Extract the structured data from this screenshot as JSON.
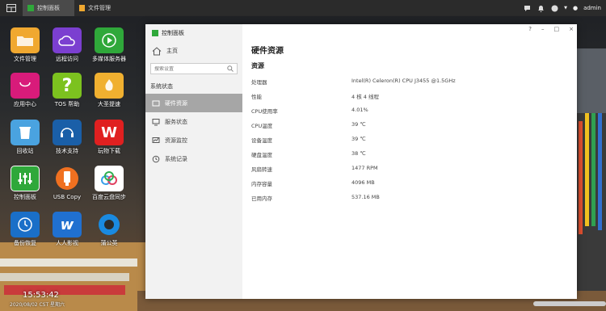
{
  "taskbar": {
    "tabs": [
      {
        "label": "控制面板",
        "active": true
      },
      {
        "label": "文件管理",
        "active": false
      }
    ],
    "user": "admin"
  },
  "desktop": {
    "icons": [
      {
        "label": "文件管理",
        "icon": "folder-icon",
        "color": "#2d2d2d"
      },
      {
        "label": "远程访问",
        "icon": "cloud-icon",
        "color": "#7b3fd0"
      },
      {
        "label": "多媒体服务器",
        "icon": "play-icon",
        "color": "#2fa83a"
      },
      {
        "label": "应用中心",
        "icon": "bag-icon",
        "color": "#d81b7a"
      },
      {
        "label": "TOS 帮助",
        "icon": "question-icon",
        "color": "#7cc21f"
      },
      {
        "label": "大圣提速",
        "icon": "flame-icon",
        "color": "#f0b030"
      },
      {
        "label": "回收站",
        "icon": "trash-icon",
        "color": "#4aa3e0"
      },
      {
        "label": "技术支持",
        "icon": "headset-icon",
        "color": "#1a5fa8"
      },
      {
        "label": "玩物下载",
        "icon": "download-icon",
        "color": "#e02020"
      },
      {
        "label": "控制面板",
        "icon": "sliders-icon",
        "color": "#2fa83a"
      },
      {
        "label": "USB Copy",
        "icon": "usb-icon",
        "color": "#f07020"
      },
      {
        "label": "百度云盘同步",
        "icon": "baidu-cloud-icon",
        "color": "#ffffff"
      },
      {
        "label": "备份恢复",
        "icon": "clock-icon",
        "color": "#1a6fc8"
      },
      {
        "label": "人人影视",
        "icon": "rr-icon",
        "color": "#2070d0"
      },
      {
        "label": "蒲公英",
        "icon": "dandelion-icon",
        "color": "#1a8ae0"
      }
    ]
  },
  "clock": {
    "time": "15:53:42",
    "date": "2020/08/02 CST 星期六"
  },
  "window": {
    "title": "控制面板",
    "controls": [
      "?",
      "–",
      "□",
      "×"
    ],
    "home": "主页",
    "search_placeholder": "搜索设置",
    "section": "系统状态",
    "nav": [
      {
        "label": "硬件资源",
        "active": true
      },
      {
        "label": "服务状态"
      },
      {
        "label": "资源监控"
      },
      {
        "label": "系统记录"
      }
    ],
    "page_title": "硬件资源",
    "section_title": "资源",
    "rows": [
      {
        "k": "处理器",
        "v": "Intel(R) Celeron(R) CPU J3455 @1.5GHz"
      },
      {
        "k": "性能",
        "v": "4 核 4 线程"
      },
      {
        "k": "CPU使用率",
        "v": "4.01%"
      },
      {
        "k": "CPU温度",
        "v": "39 ℃"
      },
      {
        "k": "设备温度",
        "v": "39 ℃"
      },
      {
        "k": "硬盘温度",
        "v": "38 ℃"
      },
      {
        "k": "风扇转速",
        "v": "1477 RPM"
      },
      {
        "k": "内存容量",
        "v": "4096 MB"
      },
      {
        "k": "已用内存",
        "v": "537.16 MB"
      }
    ]
  }
}
